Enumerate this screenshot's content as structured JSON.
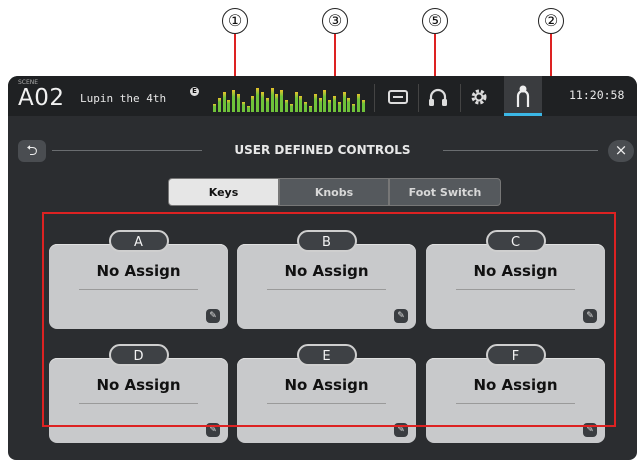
{
  "callouts": {
    "c1": "①",
    "c3": "③",
    "c5": "⑤",
    "c2": "②"
  },
  "header": {
    "scene_label": "SCENE",
    "scene_number": "A02",
    "scene_name": "Lupin the 4th",
    "scene_badge": "E",
    "clock": "11:20:58"
  },
  "screen": {
    "back_symbol": "⮌",
    "close_symbol": "×",
    "title": "USER DEFINED CONTROLS"
  },
  "tabs": [
    {
      "label": "Keys",
      "active": true
    },
    {
      "label": "Knobs",
      "active": false
    },
    {
      "label": "Foot Switch",
      "active": false
    }
  ],
  "keys": [
    {
      "letter": "A",
      "assignment": "No Assign"
    },
    {
      "letter": "B",
      "assignment": "No Assign"
    },
    {
      "letter": "C",
      "assignment": "No Assign"
    },
    {
      "letter": "D",
      "assignment": "No Assign"
    },
    {
      "letter": "E",
      "assignment": "No Assign"
    },
    {
      "letter": "F",
      "assignment": "No Assign"
    }
  ],
  "icons": {
    "top": [
      "meter-icon",
      "recorder-icon",
      "headphones-icon",
      "gear-icon",
      "user-icon"
    ],
    "edit": "edit-icon"
  },
  "colors": {
    "highlight": "#dd2222",
    "accent": "#3bb7e6",
    "meter_green": "#6fc23a",
    "meter_yellow": "#e8c22a"
  }
}
